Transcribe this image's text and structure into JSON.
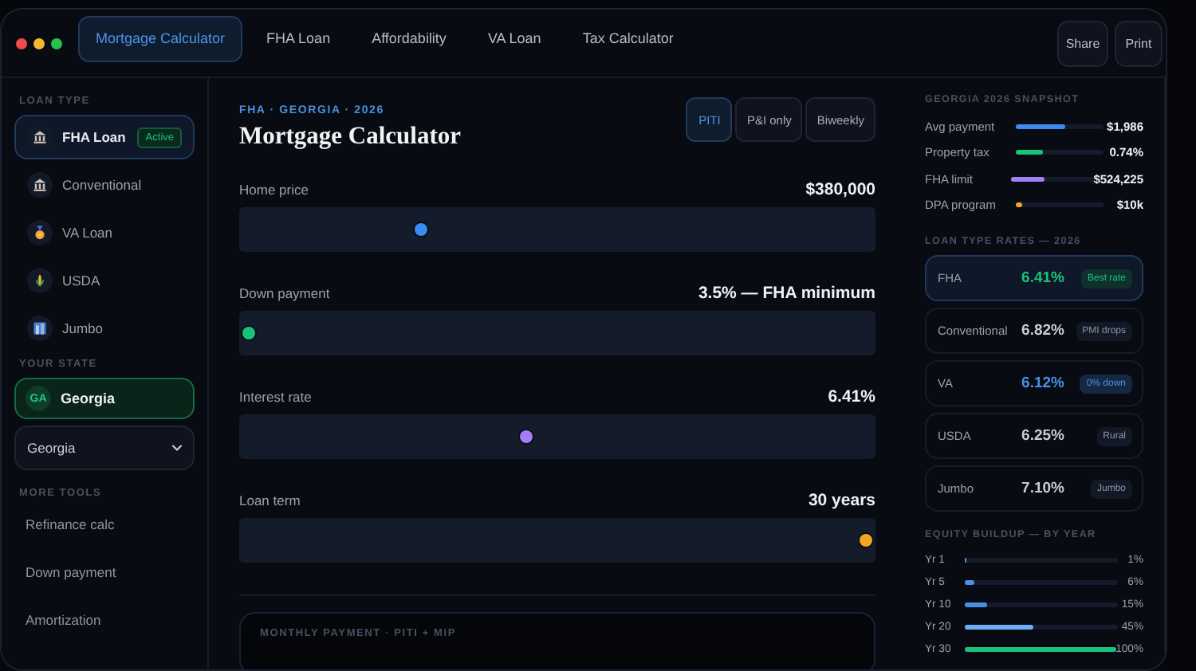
{
  "tabs": [
    {
      "label": "Mortgage Calculator",
      "selected": true
    },
    {
      "label": "FHA Loan",
      "selected": false
    },
    {
      "label": "Affordability",
      "selected": false
    },
    {
      "label": "VA Loan",
      "selected": false
    },
    {
      "label": "Tax Calculator",
      "selected": false
    }
  ],
  "actions": [
    "Share",
    "Print"
  ],
  "sidebar": {
    "loan_type_heading": "LOAN TYPE",
    "loan_types": [
      {
        "label": "FHA Loan",
        "selected": true,
        "badge": "Active"
      },
      {
        "label": "Conventional",
        "selected": false
      },
      {
        "label": "VA Loan",
        "selected": false
      },
      {
        "label": "USDA",
        "selected": false
      },
      {
        "label": "Jumbo",
        "selected": false
      }
    ],
    "state_heading": "YOUR STATE",
    "state_card": {
      "code": "GA",
      "name": "Georgia"
    },
    "state_select": {
      "value": "Georgia"
    },
    "tools_heading": "MORE TOOLS",
    "tools": [
      "Refinance calc",
      "Down payment",
      "Amortization"
    ]
  },
  "main": {
    "eyebrow": "FHA · GEORGIA · 2026",
    "title": "Mortgage Calculator",
    "modes": [
      {
        "label": "PITI",
        "selected": true
      },
      {
        "label": "P&I only",
        "selected": false
      },
      {
        "label": "Biweekly",
        "selected": false
      }
    ],
    "sliders": [
      {
        "label": "Home price",
        "reading": "$380,000",
        "level": 0.28,
        "color": "#3b8cf0"
      },
      {
        "label": "Down payment",
        "reading": "3.5% — FHA minimum",
        "level": 0.0,
        "color": "#19c47a"
      },
      {
        "label": "Interest rate",
        "reading": "6.41%",
        "level": 0.45,
        "color": "#a37ff5"
      },
      {
        "label": "Loan term",
        "reading": "30 years",
        "level": 1.0,
        "color": "#f5a524"
      }
    ],
    "result_heading": "MONTHLY PAYMENT · PITI + MIP"
  },
  "snapshot": {
    "heading": "GEORGIA 2026 SNAPSHOT",
    "rows": [
      {
        "label": "Avg payment",
        "value": "$1,986",
        "level": 0.56,
        "color": "#3b8cf0"
      },
      {
        "label": "Property tax",
        "value": "0.74%",
        "level": 0.3,
        "color": "#19c47a"
      },
      {
        "label": "FHA limit",
        "value": "$524,225",
        "level": 0.4,
        "color": "#a37ff5"
      },
      {
        "label": "DPA program",
        "value": "$10k",
        "level": 0.07,
        "color": "#f5a524"
      }
    ]
  },
  "rates": {
    "heading": "LOAN TYPE RATES — 2026",
    "items": [
      {
        "name": "FHA",
        "rate": "6.41%",
        "badge": "Best rate",
        "selected": true,
        "color": "#19c47a",
        "accent": true
      },
      {
        "name": "Conventional",
        "rate": "6.82%",
        "badge": "PMI drops",
        "selected": false,
        "color": "#c9ccd4",
        "accent": false
      },
      {
        "name": "VA",
        "rate": "6.12%",
        "badge": "0% down",
        "selected": false,
        "color": "#4a90e8",
        "accent": true
      },
      {
        "name": "USDA",
        "rate": "6.25%",
        "badge": "Rural",
        "selected": false,
        "color": "#c9ccd4",
        "accent": false
      },
      {
        "name": "Jumbo",
        "rate": "7.10%",
        "badge": "Jumbo",
        "selected": false,
        "color": "#c9ccd4",
        "accent": false
      }
    ]
  },
  "equity": {
    "heading": "EQUITY BUILDUP — BY YEAR",
    "rows": [
      {
        "label": "Yr 1",
        "value": "1%",
        "level": 0.01,
        "color": "#4a90e8"
      },
      {
        "label": "Yr 5",
        "value": "6%",
        "level": 0.06,
        "color": "#4a90e8"
      },
      {
        "label": "Yr 10",
        "value": "15%",
        "level": 0.15,
        "color": "#4a90e8"
      },
      {
        "label": "Yr 20",
        "value": "45%",
        "level": 0.45,
        "color": "#6aaef5"
      },
      {
        "label": "Yr 30",
        "value": "100%",
        "level": 1.0,
        "color": "#19c47a"
      }
    ]
  }
}
